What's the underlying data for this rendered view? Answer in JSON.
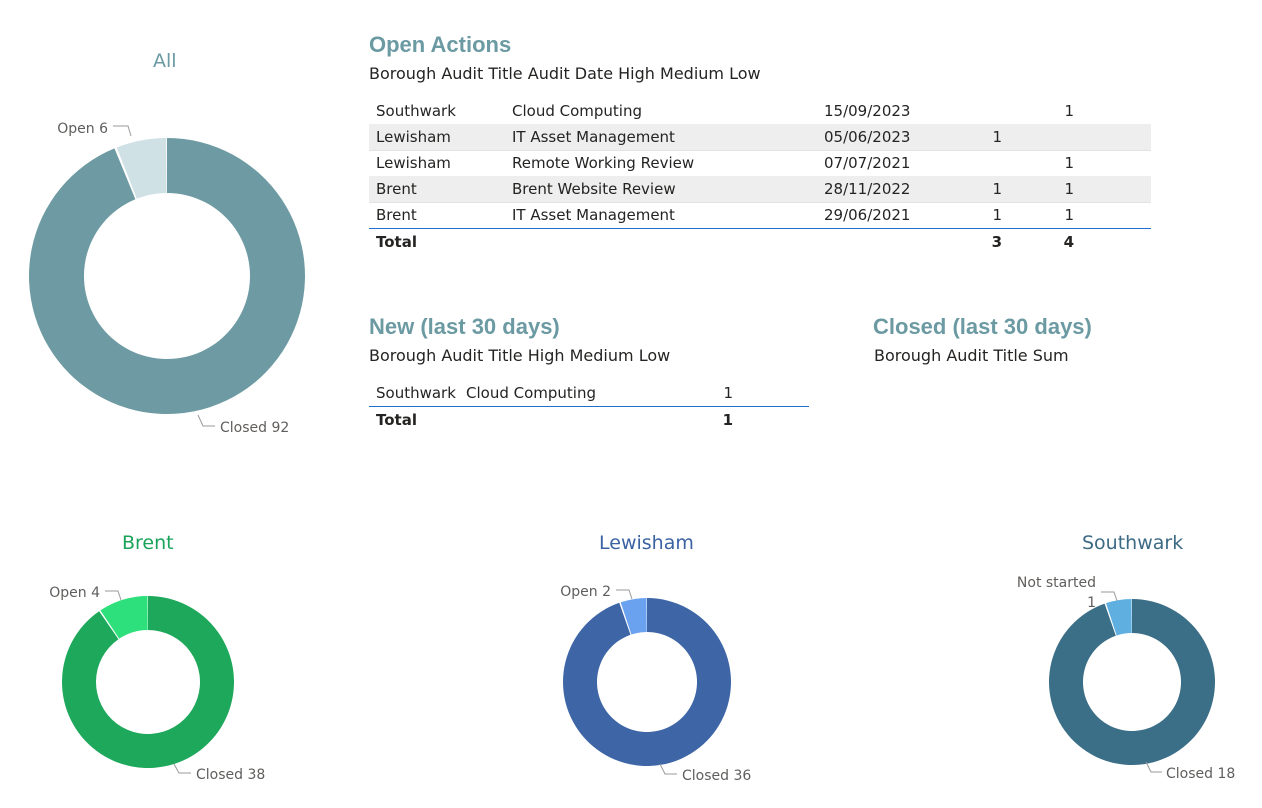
{
  "donuts": {
    "all": {
      "title": "All",
      "title_color": "#6b9aa3",
      "segments": [
        {
          "label": "Open",
          "value": 6,
          "display": "Open 6",
          "color": "#cfe1e5"
        },
        {
          "label": "Closed",
          "value": 92,
          "display": "Closed 92",
          "color": "#6e9ba3"
        }
      ]
    },
    "brent": {
      "title": "Brent",
      "title_color": "#1aa45a",
      "segments": [
        {
          "label": "Open",
          "value": 4,
          "display": "Open 4",
          "color": "#2ee07c"
        },
        {
          "label": "Closed",
          "value": 38,
          "display": "Closed 38",
          "color": "#1da85b"
        }
      ]
    },
    "lewisham": {
      "title": "Lewisham",
      "title_color": "#3b63a3",
      "segments": [
        {
          "label": "Open",
          "value": 2,
          "display": "Open 2",
          "color": "#6aa2f0"
        },
        {
          "label": "Closed",
          "value": 36,
          "display": "Closed 36",
          "color": "#3e66a6"
        }
      ]
    },
    "southwark": {
      "title": "Southwark",
      "title_color": "#3c6a85",
      "segments": [
        {
          "label": "Not started",
          "value": 1,
          "display": "Not started",
          "display2": "1",
          "color": "#5fb0e0"
        },
        {
          "label": "Closed",
          "value": 18,
          "display": "Closed 18",
          "color": "#3b6e87"
        }
      ]
    }
  },
  "open_actions": {
    "title": "Open Actions",
    "headers": {
      "borough": "Borough",
      "audit_title": "Audit Title",
      "audit_date": "Audit Date",
      "high": "High",
      "medium": "Medium",
      "low": "Low"
    },
    "rows": [
      {
        "borough": "Southwark",
        "audit_title": "Cloud Computing",
        "audit_date": "15/09/2023",
        "high": "",
        "medium": "1",
        "low": ""
      },
      {
        "borough": "Lewisham",
        "audit_title": "IT Asset Management",
        "audit_date": "05/06/2023",
        "high": "1",
        "medium": "",
        "low": ""
      },
      {
        "borough": "Lewisham",
        "audit_title": "Remote Working Review",
        "audit_date": "07/07/2021",
        "high": "",
        "medium": "1",
        "low": ""
      },
      {
        "borough": "Brent",
        "audit_title": "Brent Website Review",
        "audit_date": "28/11/2022",
        "high": "1",
        "medium": "1",
        "low": ""
      },
      {
        "borough": "Brent",
        "audit_title": "IT Asset Management",
        "audit_date": "29/06/2021",
        "high": "1",
        "medium": "1",
        "low": ""
      }
    ],
    "total": {
      "label": "Total",
      "high": "3",
      "medium": "4",
      "low": ""
    }
  },
  "new_30": {
    "title": "New (last 30 days)",
    "headers": {
      "borough": "Borough",
      "audit_title": "Audit Title",
      "high": "High",
      "medium": "Medium",
      "low": "Low"
    },
    "rows": [
      {
        "borough": "Southwark",
        "audit_title": "Cloud Computing",
        "high": "",
        "medium": "1",
        "low": ""
      }
    ],
    "total": {
      "label": "Total",
      "high": "",
      "medium": "1",
      "low": ""
    }
  },
  "closed_30": {
    "title": "Closed (last 30 days)",
    "headers": {
      "borough": "Borough",
      "audit_title": "Audit Title",
      "sum": "Sum"
    }
  }
}
